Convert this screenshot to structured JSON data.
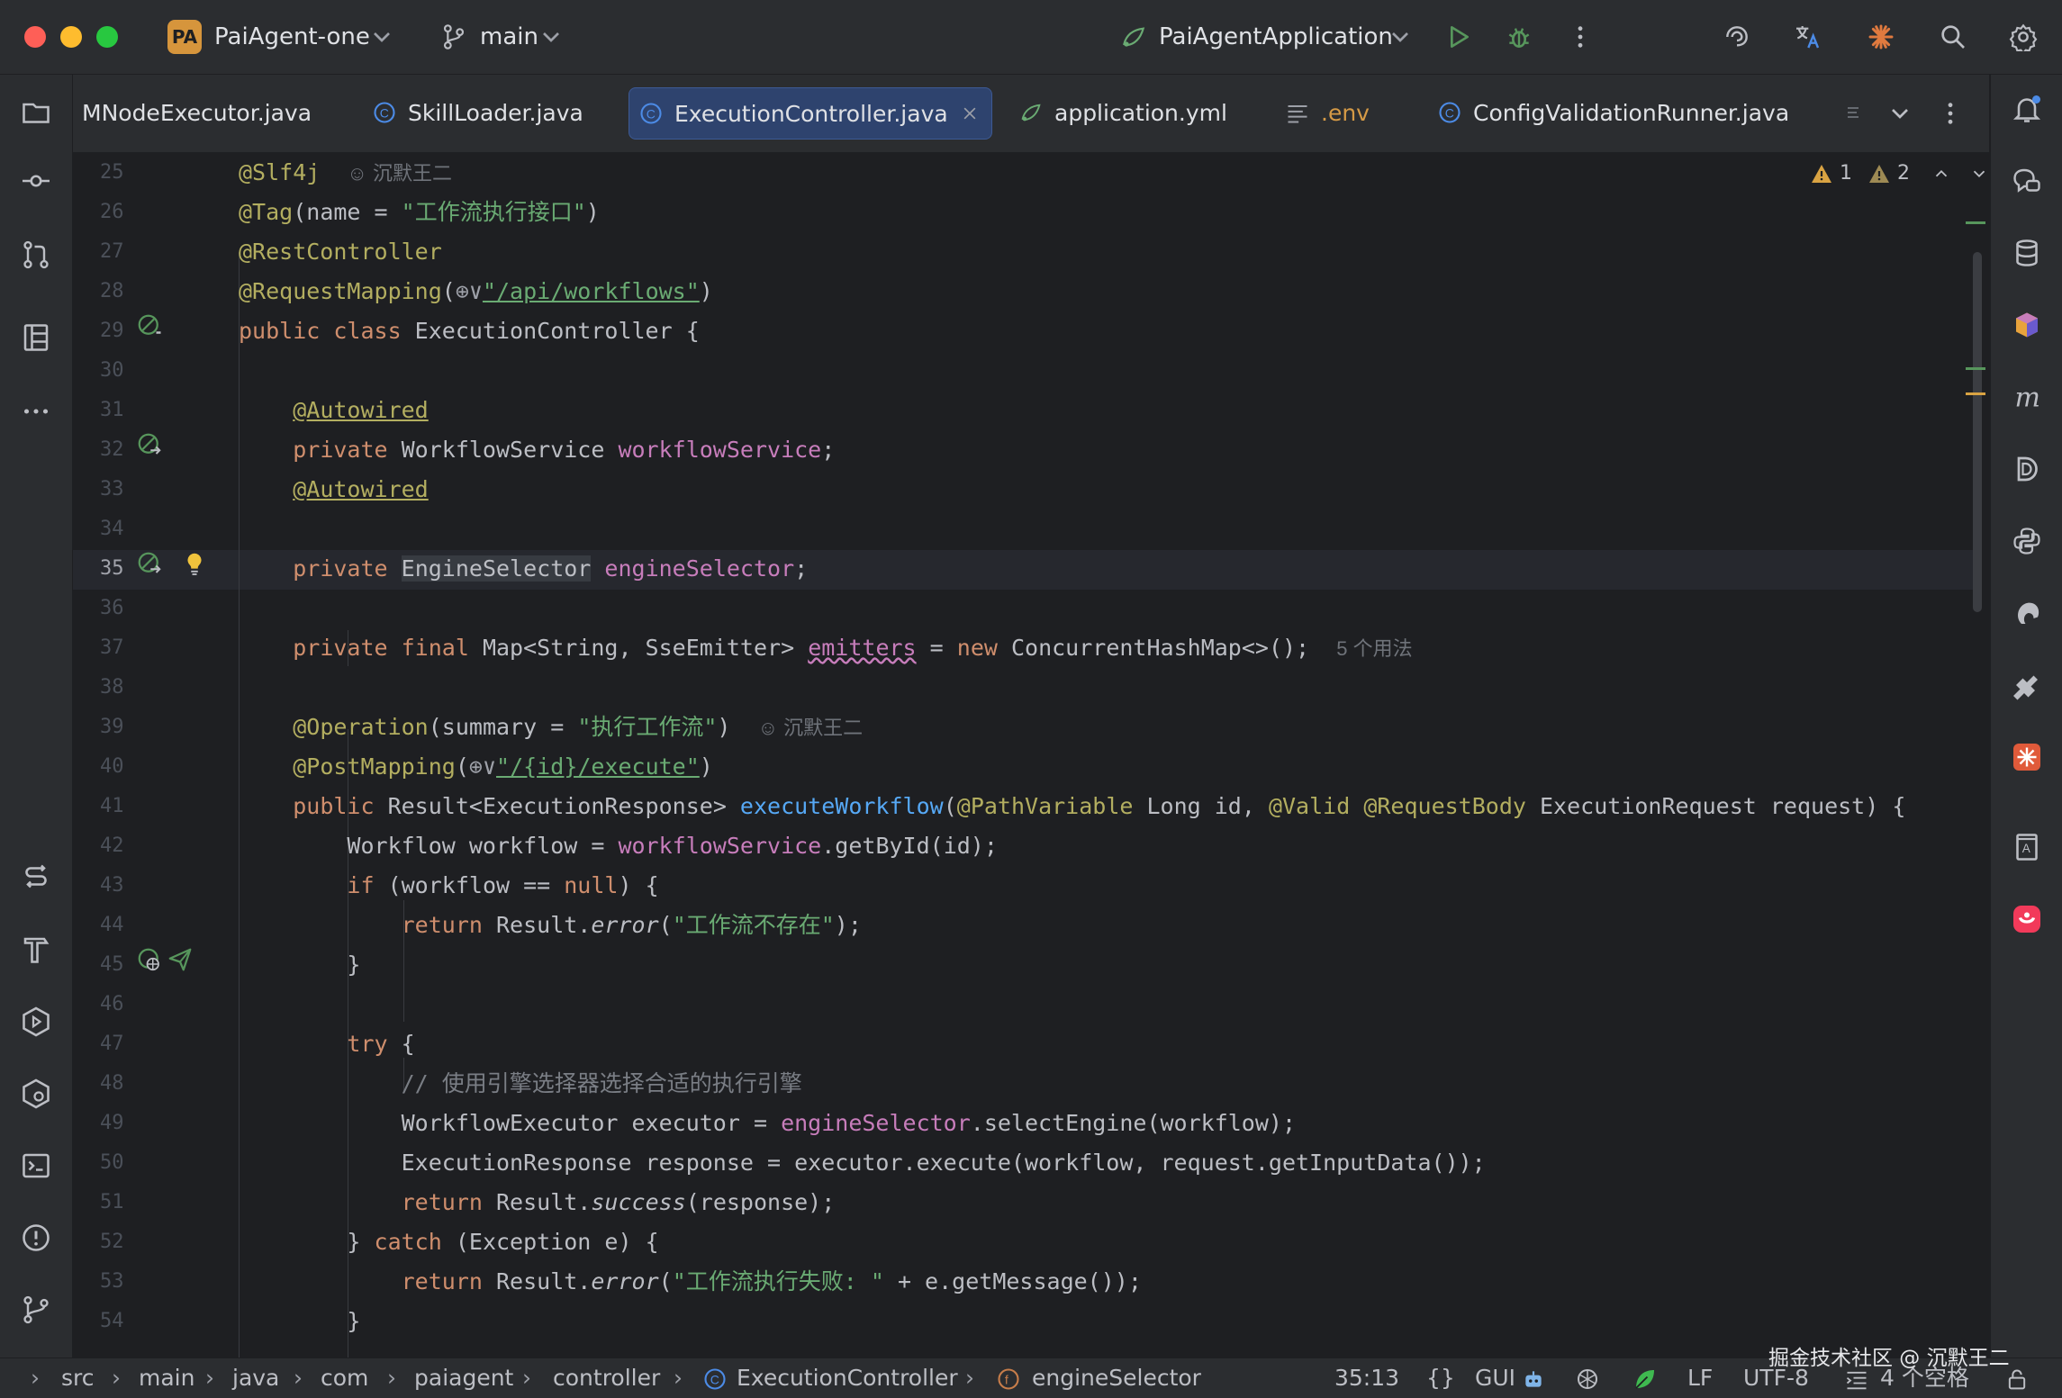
{
  "titlebar": {
    "project_badge": "PA",
    "project_name": "PaiAgent-one",
    "branch": "main",
    "run_config": "PaiAgentApplication"
  },
  "tabs": [
    {
      "label": "MNodeExecutor.java",
      "icon": "class-icon"
    },
    {
      "label": "SkillLoader.java",
      "icon": "class-icon"
    },
    {
      "label": "ExecutionController.java",
      "icon": "class-icon",
      "active": true
    },
    {
      "label": "application.yml",
      "icon": "spring-config-icon"
    },
    {
      "label": ".env",
      "icon": "text-file-icon"
    },
    {
      "label": "ConfigValidationRunner.java",
      "icon": "class-icon"
    }
  ],
  "inspections": {
    "warnings": "1",
    "weak_warnings": "2"
  },
  "lines": [
    "25",
    "26",
    "27",
    "28",
    "29",
    "30",
    "31",
    "32",
    "33",
    "34",
    "35",
    "36",
    "37",
    "38",
    "39",
    "40",
    "41",
    "42",
    "43",
    "44",
    "45",
    "46",
    "47",
    "48",
    "49",
    "50",
    "51",
    "52",
    "53",
    "54"
  ],
  "code": {
    "l25_annot": "@Slf4j",
    "l25_author": "沉默王二",
    "l26_annot": "@Tag",
    "l26_pre": "(name = ",
    "l26_str": "\"工作流执行接口\"",
    "l26_post": ")",
    "l27": "@RestController",
    "l28_annot": "@RequestMapping",
    "l28_str": "\"/api/workflows\"",
    "l29_kw": "public class",
    "l29_rest": " ExecutionController {",
    "l31": "@Autowired",
    "l32_kw": "private",
    "l32_type": " WorkflowService ",
    "l32_field": "workflowService",
    "l34": "@Autowired",
    "l35_kw": "private",
    "l35_type": "EngineSelector",
    "l35_field": "engineSelector",
    "l37_kw": "private final",
    "l37_type": " Map<String, SseEmitter> ",
    "l37_field": "emitters",
    "l37_eq": " = ",
    "l37_new": "new",
    "l37_rest": " ConcurrentHashMap<>();",
    "l37_hint": "5 个用法",
    "l39_annot": "@Operation",
    "l39_pre": "(summary = ",
    "l39_str": "\"执行工作流\"",
    "l39_post": ")",
    "l39_author": "沉默王二",
    "l40_annot": "@PostMapping",
    "l40_str": "\"/{id}/execute\"",
    "l41_kw": "public",
    "l41_type": " Result<ExecutionResponse> ",
    "l41_method": "executeWorkflow",
    "l41_a1": "@PathVariable",
    "l41_p1": " Long id, ",
    "l41_a2": "@Valid",
    "l41_a3": "@RequestBody",
    "l41_p2": " ExecutionRequest request) {",
    "l42_a": "Workflow workflow = ",
    "l42_field": "workflowService",
    "l42_b": ".getById(id);",
    "l43_kw": "if",
    "l43_a": " (workflow == ",
    "l43_null": "null",
    "l43_b": ") {",
    "l44_kw": "return",
    "l44_a": " Result.",
    "l44_m": "error",
    "l44_str": "\"工作流不存在\"",
    "l44_b": ");",
    "l45": "}",
    "l47_kw": "try",
    "l47_b": " {",
    "l48": "// 使用引擎选择器选择合适的执行引擎",
    "l49_a": "WorkflowExecutor executor = ",
    "l49_field": "engineSelector",
    "l49_b": ".selectEngine(workflow);",
    "l50": "ExecutionResponse response = executor.execute(workflow, request.getInputData());",
    "l51_kw": "return",
    "l51_a": " Result.",
    "l51_m": "success",
    "l51_b": "(response);",
    "l52_a": "} ",
    "l52_kw": "catch",
    "l52_b": " (Exception e) {",
    "l53_kw": "return",
    "l53_a": " Result.",
    "l53_m": "error",
    "l53_str": "\"工作流执行失败: \"",
    "l53_b": " + e.getMessage());",
    "l54": "}"
  },
  "breadcrumb": [
    "src",
    "main",
    "java",
    "com",
    "paiagent",
    "controller",
    "ExecutionController",
    "engineSelector"
  ],
  "status": {
    "position": "35:13",
    "gui": "GUI",
    "line_sep": "LF",
    "encoding": "UTF-8",
    "indent": "4 个空格",
    "watermark": "掘金技术社区 @ 沉默王二"
  }
}
